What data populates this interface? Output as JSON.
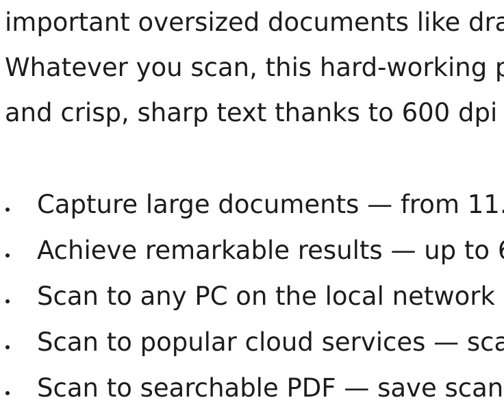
{
  "intro_lines": [
    "important oversized documents like dra",
    "Whatever you scan, this hard-working p",
    "and crisp, sharp text thanks to 600 dpi r"
  ],
  "bullets": [
    "Capture large documents — from 11.7",
    "Achieve remarkable results — up to 6",
    "Scan to any PC on the local network",
    "Scan to popular cloud services — sca",
    "Scan to searchable PDF — save scan"
  ]
}
